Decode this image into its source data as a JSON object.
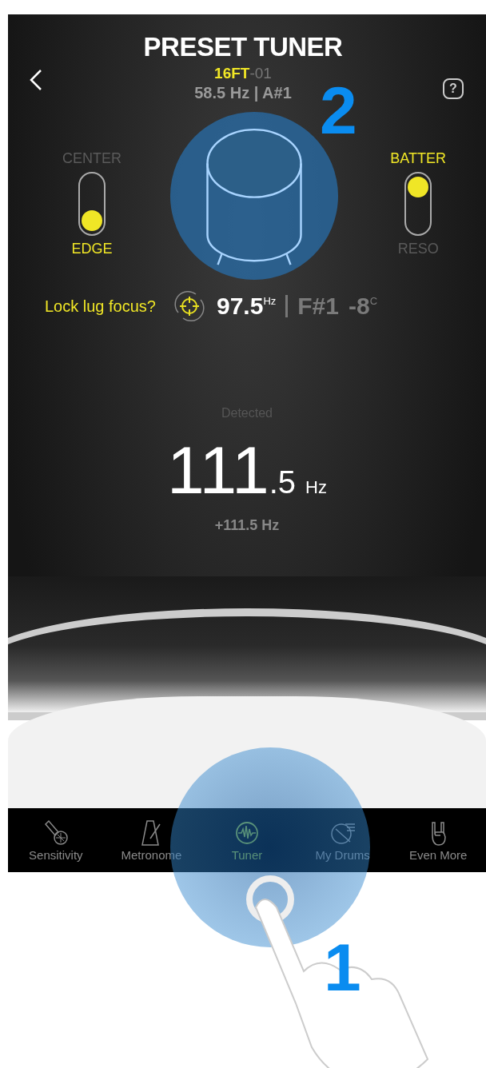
{
  "header": {
    "title": "PRESET TUNER",
    "preset_code": "16FT",
    "preset_suffix": "-01",
    "target": "58.5 Hz | A#1",
    "help": "?"
  },
  "toggles": [
    {
      "options": [
        {
          "label": "CENTER",
          "selected": false
        },
        {
          "label": "EDGE",
          "selected": true
        }
      ]
    },
    {
      "options": [
        {
          "label": "BATTER",
          "selected": true
        },
        {
          "label": "RESO",
          "selected": false
        }
      ]
    }
  ],
  "lock": {
    "label": "Lock lug focus?",
    "reading": "97.5",
    "unit": "Hz",
    "note": "F#1",
    "cents": "-8",
    "cents_unit": "C"
  },
  "detected": {
    "label": "Detected",
    "whole": "111",
    "decimal": ".5",
    "unit": "Hz",
    "delta": "+111.5 Hz"
  },
  "tabs": [
    {
      "label": "Sensitivity",
      "kind": "microphone",
      "selected": false
    },
    {
      "label": "Metronome",
      "kind": "metronome",
      "selected": false
    },
    {
      "label": "Tuner",
      "kind": "tuner",
      "selected": true
    },
    {
      "label": "My Drums",
      "kind": "drums",
      "selected": false
    },
    {
      "label": "Even More",
      "kind": "hand",
      "selected": false
    }
  ],
  "callouts": [
    "2",
    "1"
  ]
}
